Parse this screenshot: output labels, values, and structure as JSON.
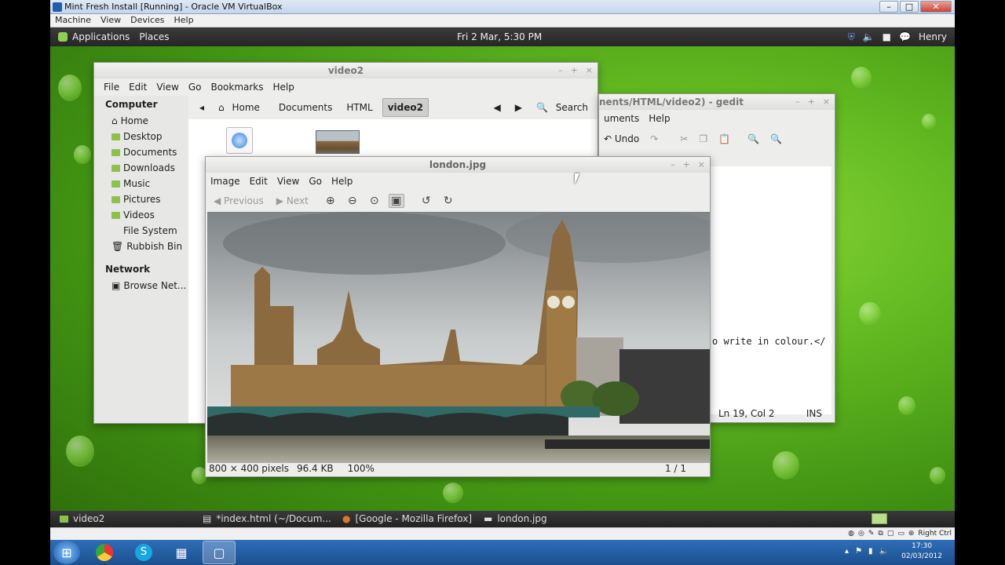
{
  "host": {
    "window_title": "Mint Fresh Install [Running] - Oracle VM VirtualBox",
    "menu": [
      "Machine",
      "View",
      "Devices",
      "Help"
    ],
    "host_key": "Right Ctrl",
    "clock_time": "17:30",
    "clock_date": "02/03/2012"
  },
  "panel": {
    "applications": "Applications",
    "places": "Places",
    "clock": "Fri  2 Mar,  5:30 PM",
    "user": "Henry"
  },
  "file_manager": {
    "title": "video2",
    "menu": [
      "File",
      "Edit",
      "View",
      "Go",
      "Bookmarks",
      "Help"
    ],
    "sidebar_header_computer": "Computer",
    "sidebar_items": [
      "Home",
      "Desktop",
      "Documents",
      "Downloads",
      "Music",
      "Pictures",
      "Videos",
      "File System",
      "Rubbish Bin"
    ],
    "sidebar_header_network": "Network",
    "network_item": "Browse Net...",
    "path": [
      "Home",
      "Documents",
      "HTML"
    ],
    "path_current": "video2",
    "search": "Search"
  },
  "gedit": {
    "title": "nents/HTML/video2) - gedit",
    "menu": [
      "uments",
      "Help"
    ],
    "undo": "Undo",
    "code_line": "o write in colour.</",
    "position": "Ln 19, Col 2",
    "mode": "INS"
  },
  "image_viewer": {
    "title": "london.jpg",
    "menu": [
      "Image",
      "Edit",
      "View",
      "Go",
      "Help"
    ],
    "previous": "Previous",
    "next": "Next",
    "dimensions": "800 × 400 pixels",
    "size": "96.4 KB",
    "zoom": "100%",
    "index": "1 / 1"
  },
  "taskbar": {
    "items": [
      "video2",
      "*index.html (~/Docum...",
      "[Google - Mozilla Firefox]",
      "london.jpg"
    ]
  }
}
